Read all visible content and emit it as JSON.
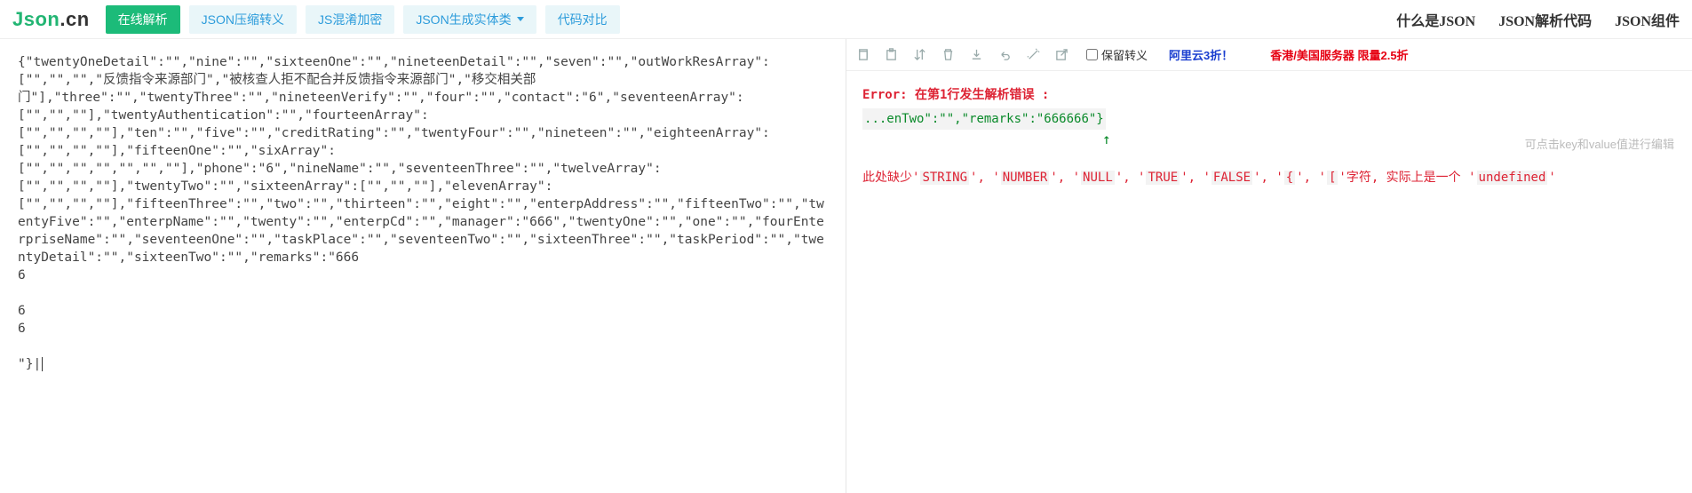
{
  "logo": {
    "accent": "Json",
    "rest": ".cn"
  },
  "nav_left": {
    "primary": "在线解析",
    "items": [
      "JSON压缩转义",
      "JS混淆加密",
      "JSON生成实体类",
      "代码对比"
    ],
    "dropdown_index": 2
  },
  "nav_right": [
    "什么是JSON",
    "JSON解析代码",
    "JSON组件"
  ],
  "input_text": "{\"twentyOneDetail\":\"\",\"nine\":\"\",\"sixteenOne\":\"\",\"nineteenDetail\":\"\",\"seven\":\"\",\"outWorkResArray\":[\"\",\"\",\"\",\"反馈指令来源部门\",\"被核查人拒不配合并反馈指令来源部门\",\"移交相关部\n门\"],\"three\":\"\",\"twentyThree\":\"\",\"nineteenVerify\":\"\",\"four\":\"\",\"contact\":\"6\",\"seventeenArray\":[\"\",\"\",\"\"],\"twentyAuthentication\":\"\",\"fourteenArray\":\n[\"\",\"\",\"\",\"\"],\"ten\":\"\",\"five\":\"\",\"creditRating\":\"\",\"twentyFour\":\"\",\"nineteen\":\"\",\"eighteenArray\":[\"\",\"\",\"\",\"\"],\"fifteenOne\":\"\",\"sixArray\":\n[\"\",\"\",\"\",\"\",\"\",\"\",\"\"],\"phone\":\"6\",\"nineName\":\"\",\"seventeenThree\":\"\",\"twelveArray\":\n[\"\",\"\",\"\",\"\"],\"twentyTwo\":\"\",\"sixteenArray\":[\"\",\"\",\"\"],\"elevenArray\":\n[\"\",\"\",\"\",\"\"],\"fifteenThree\":\"\",\"two\":\"\",\"thirteen\":\"\",\"eight\":\"\",\"enterpAddress\":\"\",\"fifteenTwo\":\"\",\"twentyFive\":\"\",\"enterpName\":\"\",\"twenty\":\"\",\"enterpCd\":\"\",\"manager\":\"666\",\"twentyOne\":\"\",\"one\":\"\",\"fourEnterpriseName\":\"\",\"seventeenOne\":\"\",\"taskPlace\":\"\",\"seventeenTwo\":\"\",\"sixteenThree\":\"\",\"taskPeriod\":\"\",\"twentyDetail\":\"\",\"sixteenTwo\":\"\",\"remarks\":\"666\n6\n\n6\n6\n\n\"}|",
  "toolbar": {
    "icons": [
      "copy",
      "paste",
      "sort",
      "trash",
      "download",
      "undo",
      "wand",
      "external"
    ],
    "preserve_label": "保留转义",
    "promo1": "阿里云3折！",
    "promo2": "香港/美国服务器 限量2.5折"
  },
  "result": {
    "hint": "可点击key和value值进行编辑",
    "err_title": "Error: 在第1行发生解析错误 :",
    "err_snippet": "...enTwo\":\"\",\"remarks\":\"666666\"}",
    "missing_prefix": "此处缺少'",
    "tokens": [
      "STRING",
      "NUMBER",
      "NULL",
      "TRUE",
      "FALSE",
      "{",
      "["
    ],
    "sep": "', '",
    "missing_suffix": "'字符, 实际上是一个 '",
    "actual": "undefined",
    "tail": "'"
  }
}
